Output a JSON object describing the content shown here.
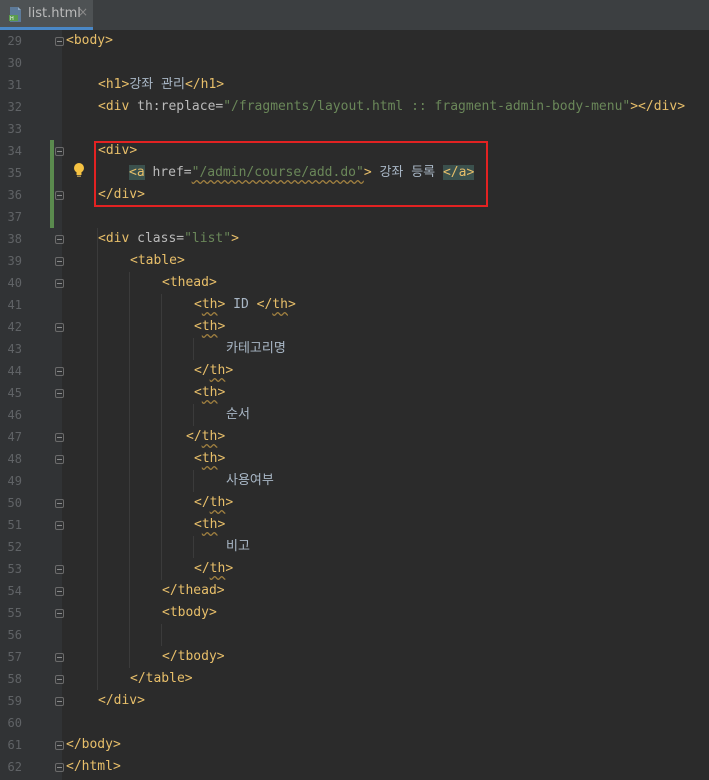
{
  "tab": {
    "title": "list.html",
    "close": "×",
    "icon": "html-file-icon"
  },
  "line_numbers": [
    "29",
    "30",
    "31",
    "32",
    "33",
    "34",
    "35",
    "36",
    "37",
    "38",
    "39",
    "40",
    "41",
    "42",
    "43",
    "44",
    "45",
    "46",
    "47",
    "48",
    "49",
    "50",
    "51",
    "52",
    "53",
    "54",
    "55",
    "56",
    "57",
    "58",
    "59",
    "60",
    "61",
    "62"
  ],
  "code": {
    "l29": {
      "open": "<",
      "tag": "body",
      "close": ">"
    },
    "l31": {
      "open": "<",
      "tag": "h1",
      "gt": ">",
      "text": "강좌 관리",
      "eopen": "</",
      "etag": "h1",
      "eclose": ">"
    },
    "l32": {
      "open": "<",
      "tag": "div",
      "attr": " th:replace=",
      "val": "\"/fragments/layout.html :: fragment-admin-body-menu\"",
      "mid": "></",
      "etag": "div",
      "eclose": ">"
    },
    "l34": {
      "open": "<",
      "tag": "div",
      "close": ">"
    },
    "l35": {
      "open": "<",
      "tag": "a",
      "attr": " href=",
      "val": "\"/admin/course/add.do\"",
      "gt": ">",
      "text": " 강좌 등록 ",
      "eopen": "</",
      "etag": "a",
      "eclose": ">"
    },
    "l36": {
      "open": "</",
      "tag": "div",
      "close": ">"
    },
    "l38": {
      "open": "<",
      "tag": "div",
      "attr": " class=",
      "val": "\"list\"",
      "close": ">"
    },
    "l39": {
      "open": "<",
      "tag": "table",
      "close": ">"
    },
    "l40": {
      "open": "<",
      "tag": "thead",
      "close": ">"
    },
    "l41": {
      "open": "<",
      "tag": "th",
      "gt": ">",
      "text": " ID ",
      "eopen": "</",
      "etag": "th",
      "eclose": ">"
    },
    "l42": {
      "open": "<",
      "tag": "th",
      "close": ">"
    },
    "l43": {
      "text": "카테고리명"
    },
    "l44": {
      "open": "</",
      "tag": "th",
      "close": ">"
    },
    "l45": {
      "open": "<",
      "tag": "th",
      "close": ">"
    },
    "l46": {
      "text": "순서"
    },
    "l47": {
      "open": "</",
      "tag": "th",
      "close": ">"
    },
    "l48": {
      "open": "<",
      "tag": "th",
      "close": ">"
    },
    "l49": {
      "text": "사용여부"
    },
    "l50": {
      "open": "</",
      "tag": "th",
      "close": ">"
    },
    "l51": {
      "open": "<",
      "tag": "th",
      "close": ">"
    },
    "l52": {
      "text": "비고"
    },
    "l53": {
      "open": "</",
      "tag": "th",
      "close": ">"
    },
    "l54": {
      "open": "</",
      "tag": "thead",
      "close": ">"
    },
    "l55": {
      "open": "<",
      "tag": "tbody",
      "close": ">"
    },
    "l57": {
      "open": "</",
      "tag": "tbody",
      "close": ">"
    },
    "l58": {
      "open": "</",
      "tag": "table",
      "close": ">"
    },
    "l59": {
      "open": "</",
      "tag": "div",
      "close": ">"
    },
    "l61": {
      "open": "</",
      "tag": "body",
      "close": ">"
    },
    "l62": {
      "open": "</",
      "tag": "html",
      "close": ">"
    }
  },
  "colors": {
    "tag": "#e8bf6a",
    "attribute": "#bababa",
    "string": "#6a8759",
    "text": "#a9b7c6",
    "highlight_box": "#e32222",
    "vcs_change": "#5a8a4e"
  },
  "intention_icon": "lightbulb-icon"
}
